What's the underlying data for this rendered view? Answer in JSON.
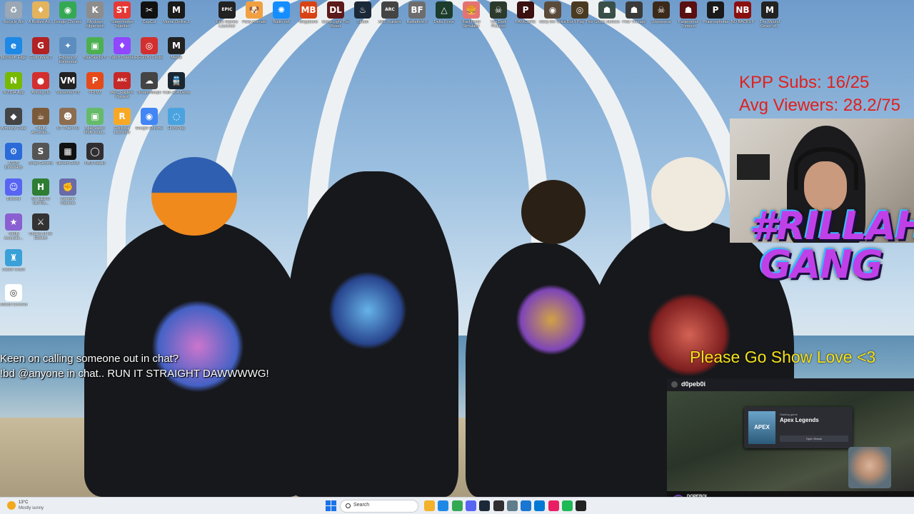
{
  "desktop_icons": [
    {
      "label": "Recycle Bin",
      "icon": "recycle-bin-icon",
      "color": "#9aa7b4",
      "glyph": "♻"
    },
    {
      "label": "Microsoft Edge",
      "icon": "edge-icon",
      "color": "#1e88e5",
      "glyph": "e"
    },
    {
      "label": "NVIDIA App",
      "icon": "nvidia-icon",
      "color": "#76b900",
      "glyph": "N"
    },
    {
      "label": "Armoury Crate",
      "icon": "armoury-crate-icon",
      "color": "#444",
      "glyph": "◆"
    },
    {
      "label": "ASUS DriverHub",
      "icon": "asus-icon",
      "color": "#2a6ad9",
      "glyph": "⚙"
    },
    {
      "label": "Discord",
      "icon": "discord-icon",
      "color": "#5865f2",
      "glyph": "☺"
    },
    {
      "label": "Totally Accurate...",
      "icon": "game-icon",
      "color": "#8a5fd1",
      "glyph": "★"
    },
    {
      "label": "Castle Crush",
      "icon": "game-icon",
      "color": "#3aa0d8",
      "glyph": "♜"
    },
    {
      "label": "Ubisoft Connect",
      "icon": "ubisoft-icon",
      "color": "#fff",
      "glyph": "◎"
    },
    {
      "label": "A Bottled Ad...",
      "icon": "game-icon",
      "color": "#e3b45c",
      "glyph": "♦"
    },
    {
      "label": "Guild Wars 2",
      "icon": "guild-wars-icon",
      "color": "#b22222",
      "glyph": "G"
    },
    {
      "label": "Among Us",
      "icon": "among-us-icon",
      "color": "#d32f2f",
      "glyph": "●"
    },
    {
      "label": "Totally Accurate...",
      "icon": "game-icon",
      "color": "#7b5a3a",
      "glyph": "☕"
    },
    {
      "label": "Snap Camera",
      "icon": "snap-camera-icon",
      "color": "#555",
      "glyph": "S"
    },
    {
      "label": "MY HERO ULTRA...",
      "icon": "game-icon",
      "color": "#2e7d32",
      "glyph": "H"
    },
    {
      "label": "Chains of the Eldritch",
      "icon": "game-icon",
      "color": "#333",
      "glyph": "⚔"
    },
    {
      "label": "Google Chrome",
      "icon": "chrome-icon",
      "color": "#34a853",
      "glyph": "◉"
    },
    {
      "label": "Echoes of Elemental",
      "icon": "game-icon",
      "color": "#5c8dbf",
      "glyph": "✦"
    },
    {
      "label": "Voicemod V3",
      "icon": "voicemod-icon",
      "color": "#222",
      "glyph": "VM"
    },
    {
      "label": "NT Thien Vu",
      "icon": "game-icon",
      "color": "#8c6d4f",
      "glyph": "☻"
    },
    {
      "label": "Stream Deck",
      "icon": "stream-deck-icon",
      "color": "#111",
      "glyph": "▦"
    },
    {
      "label": "Pummel Warriors",
      "icon": "game-icon",
      "color": "#6a6aa8",
      "glyph": "✊"
    },
    {
      "label": "Windows Kilgamesh",
      "icon": "game-icon",
      "color": "#8d8d8d",
      "glyph": "K"
    },
    {
      "label": "BlueStacks 5",
      "icon": "bluestacks-icon",
      "color": "#4caf50",
      "glyph": "▣"
    },
    {
      "label": "PRISM",
      "icon": "prism-icon",
      "color": "#e64a19",
      "glyph": "P"
    },
    {
      "label": "BlueStacks Multi-Insta...",
      "icon": "bluestacks-icon",
      "color": "#66bb6a",
      "glyph": "▣"
    },
    {
      "label": "OBS Studio",
      "icon": "obs-icon",
      "color": "#302e31",
      "glyph": "◯"
    },
    {
      "label": "Supermarket Together",
      "icon": "game-icon",
      "color": "#e53935",
      "glyph": "ST"
    },
    {
      "label": "Twitch Overlay",
      "icon": "twitch-icon",
      "color": "#9146ff",
      "glyph": "♦"
    },
    {
      "label": "ARC Raiders Playtest",
      "icon": "game-icon",
      "color": "#c62828",
      "glyph": "ARC"
    },
    {
      "label": "Rockstar Launcher",
      "icon": "rockstar-icon",
      "color": "#f9a825",
      "glyph": "R"
    },
    {
      "label": "CapCut",
      "icon": "capcut-icon",
      "color": "#111",
      "glyph": "✂"
    },
    {
      "label": "REGION Centre",
      "icon": "game-icon",
      "color": "#d32f2f",
      "glyph": "◎"
    },
    {
      "label": "Dream Morph",
      "icon": "game-icon",
      "color": "#444",
      "glyph": "☁"
    },
    {
      "label": "Google Chrome",
      "icon": "chrome-icon",
      "color": "#4285f4",
      "glyph": "◉"
    },
    {
      "label": "Mortal Online 2",
      "icon": "game-icon",
      "color": "#1a1a1a",
      "glyph": "M"
    },
    {
      "label": "Medal",
      "icon": "medal-icon",
      "color": "#222",
      "glyph": "M"
    },
    {
      "label": "Train 404 Demo",
      "icon": "game-icon",
      "color": "#1a2630",
      "glyph": "🚆"
    },
    {
      "label": "HoYoPlay",
      "icon": "hoyoplay-icon",
      "color": "#4aa3df",
      "glyph": "◌"
    },
    {
      "label": "Epic Games Launcher",
      "icon": "epic-games-icon",
      "color": "#222",
      "glyph": "EPIC"
    },
    {
      "label": "Party Animals",
      "icon": "game-icon",
      "color": "#f0a040",
      "glyph": "🐶"
    },
    {
      "label": "Battle.net",
      "icon": "battlenet-icon",
      "color": "#148eff",
      "glyph": "✺"
    },
    {
      "label": "Megabonk",
      "icon": "game-icon",
      "color": "#d84315",
      "glyph": "MB"
    },
    {
      "label": "Dying Light The Beast",
      "icon": "game-icon",
      "color": "#5d1a1a",
      "glyph": "DL"
    },
    {
      "label": "Steam",
      "icon": "steam-icon",
      "color": "#1b2838",
      "glyph": "♨"
    },
    {
      "label": "ARC Raiders",
      "icon": "game-icon",
      "color": "#444",
      "glyph": "ARC"
    },
    {
      "label": "Battlefield 6",
      "icon": "game-icon",
      "color": "#6d6d6d",
      "glyph": "BF"
    },
    {
      "label": "Delta Force",
      "icon": "game-icon",
      "color": "#1c3c2c",
      "glyph": "△"
    },
    {
      "label": "Fast Food Simulator",
      "icon": "game-icon",
      "color": "#e57373",
      "glyph": "🍔"
    },
    {
      "label": "The Dark Pictures",
      "icon": "game-icon",
      "color": "#2c3a2c",
      "glyph": "☠"
    },
    {
      "label": "PANICORE",
      "icon": "game-icon",
      "color": "#3b1010",
      "glyph": "P"
    },
    {
      "label": "Obey the Voice",
      "icon": "game-icon",
      "color": "#5a4a3a",
      "glyph": "◉"
    },
    {
      "label": "Don't Play This",
      "icon": "game-icon",
      "color": "#4a3a20",
      "glyph": "◎"
    },
    {
      "label": "Ghost Janitors",
      "icon": "game-icon",
      "color": "#385048",
      "glyph": "☗"
    },
    {
      "label": "Fear Therapy",
      "icon": "game-icon",
      "color": "#3a3a3a",
      "glyph": "☗"
    },
    {
      "label": "Unpossess",
      "icon": "game-icon",
      "color": "#3b2a1a",
      "glyph": "☠"
    },
    {
      "label": "Paranormal Torment",
      "icon": "game-icon",
      "color": "#5a1010",
      "glyph": "☗"
    },
    {
      "label": "Phasmophobia",
      "icon": "game-icon",
      "color": "#1a1a1a",
      "glyph": "P"
    },
    {
      "label": "NO BACKUP",
      "icon": "game-icon",
      "color": "#8a1010",
      "glyph": "NB"
    },
    {
      "label": "The Mound Omen of...",
      "icon": "game-icon",
      "color": "#222",
      "glyph": "M"
    }
  ],
  "overlays": {
    "kpp_subs": "KPP Subs: 16/25",
    "avg_viewers": "Avg Viewers: 28.2/75",
    "gang_line1": "#RILLAH",
    "gang_line2": "GANG",
    "callout_line1": "Keen on calling someone out in chat?",
    "callout_line2": "!bd @anyone in chat.. RUN IT STRAIGHT DAWWWWG!",
    "love": "Please Go Show Love <3"
  },
  "stream": {
    "channel_name": "d0peb0i",
    "popup_small": "Starting game",
    "popup_game": "Apex Legends",
    "popup_cover": "APEX",
    "popup_button": "Open Steam",
    "footer_channel": "DOPEBOI",
    "footer_sub": "OBD Rematch | Stay Positive | KoreGame | PEKANKE",
    "colors": {
      "accent": "#9146ff"
    }
  },
  "taskbar": {
    "temperature": "13°C",
    "condition": "Mostly sunny",
    "search_placeholder": "Search",
    "icons": [
      "file-explorer-icon",
      "edge-icon",
      "chrome-icon",
      "discord-icon",
      "steam-icon",
      "obs-icon",
      "settings-icon",
      "store-icon",
      "mail-icon",
      "photos-icon",
      "spotify-icon",
      "terminal-icon"
    ]
  }
}
